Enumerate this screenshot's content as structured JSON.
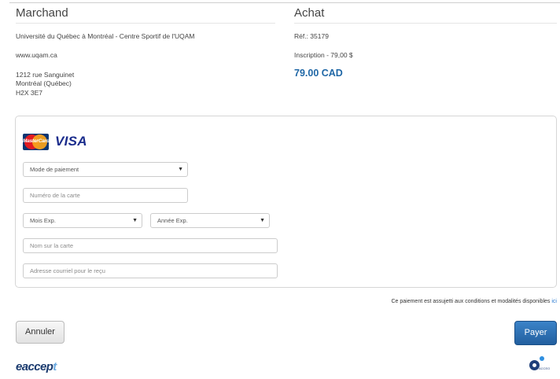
{
  "merchant": {
    "heading": "Marchand",
    "name": "Université du Québec à Montréal - Centre Sportif de l'UQAM",
    "website": "www.uqam.ca",
    "address_line1": "1212 rue Sanguinet",
    "address_line2": "Montréal (Québec)",
    "address_line3": "H2X 3E7"
  },
  "purchase": {
    "heading": "Achat",
    "reference": "Réf.: 35179",
    "description": "Inscription - 79,00 $",
    "amount": "79.00 CAD"
  },
  "card_logos": {
    "mastercard": "MasterCard",
    "visa": "VISA"
  },
  "form": {
    "payment_method": {
      "value": "Mode de paiement",
      "options": [
        "Mode de paiement"
      ]
    },
    "card_number": {
      "placeholder": "Numéro de la carte"
    },
    "exp_month": {
      "value": "Mois Exp."
    },
    "exp_year": {
      "value": "Année Exp."
    },
    "card_name": {
      "placeholder": "Nom sur la carte"
    },
    "email": {
      "placeholder": "Adresse courriel pour le reçu"
    },
    "dropdown_arrow": "▼"
  },
  "terms": {
    "text": "Ce paiement est assujetti aux conditions et modalités disponibles",
    "link": "ici"
  },
  "buttons": {
    "cancel": "Annuler",
    "pay": "Payer"
  },
  "footer": {
    "logo_eaccept_e": "e",
    "logo_eaccept_rest": "accep",
    "logo_eaccept_x": "t",
    "logo_acceo": "ACCEO"
  },
  "colors": {
    "accent": "#1f67a6",
    "pay_button": "#2a6aad",
    "link": "#2a7ad1"
  }
}
